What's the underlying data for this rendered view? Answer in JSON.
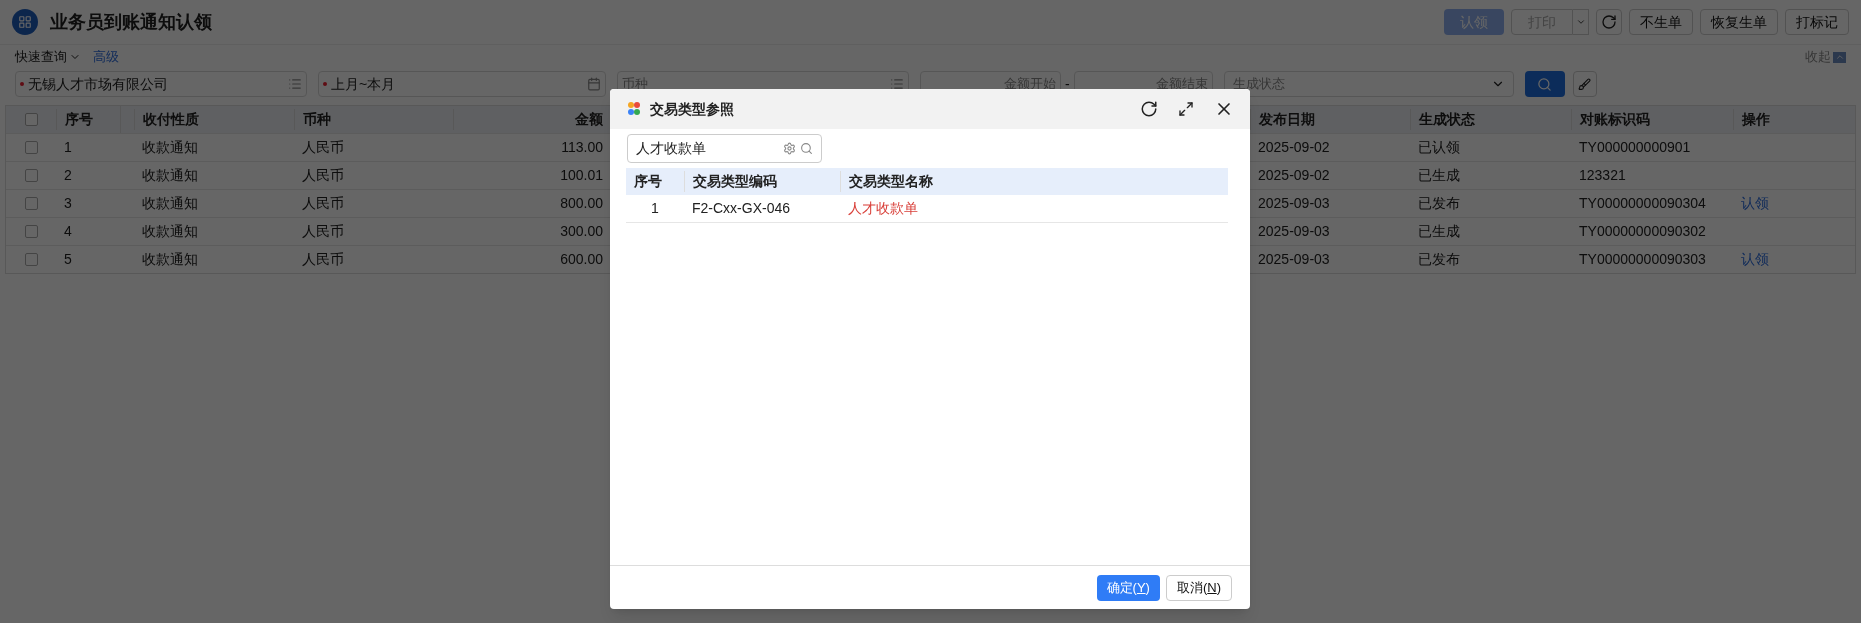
{
  "page": {
    "title": "业务员到账通知认领"
  },
  "toolbar": [
    {
      "kind": "primary",
      "label": "认领",
      "disabled": true
    },
    {
      "kind": "split",
      "label": "打印",
      "disabled": true
    },
    {
      "kind": "refresh"
    },
    {
      "kind": "default",
      "label": "不生单",
      "disabled": false
    },
    {
      "kind": "default",
      "label": "恢复生单",
      "disabled": false
    },
    {
      "kind": "default",
      "label": "打标记",
      "disabled": false
    }
  ],
  "query": {
    "quick": "快速查询",
    "advanced": "高级",
    "collapse": "收起"
  },
  "filters": [
    {
      "kind": "list",
      "value": "无锡人才市场有限公司",
      "required": true
    },
    {
      "kind": "date",
      "value": "上月~本月",
      "required": true
    },
    {
      "kind": "list",
      "placeholder": "币种",
      "required": false
    },
    {
      "kind": "range",
      "placeholder_from": "金额开始",
      "separator": "-",
      "placeholder_to": "金额结束"
    },
    {
      "kind": "dropdown",
      "placeholder": "生成状态"
    }
  ],
  "table": {
    "all_checked": false,
    "columns_left": [
      "序号",
      "收付性质",
      "币种",
      "金额"
    ],
    "columns_right": [
      "发布日期",
      "生成状态",
      "对账标识码",
      "操作"
    ],
    "rows": [
      {
        "checked": false,
        "seq": "1",
        "nature": "收款通知",
        "currency": "人民币",
        "amount": "113.00",
        "date": "2025-09-02",
        "status": "已认领",
        "code": "TY000000000901"
      },
      {
        "checked": false,
        "seq": "2",
        "nature": "收款通知",
        "currency": "人民币",
        "amount": "100.01",
        "date": "2025-09-02",
        "status": "已生成",
        "code": "123321"
      },
      {
        "checked": false,
        "seq": "3",
        "nature": "收款通知",
        "currency": "人民币",
        "amount": "800.00",
        "date": "2025-09-03",
        "status": "已发布",
        "code": "TY00000000090304",
        "action": "认领"
      },
      {
        "checked": false,
        "seq": "4",
        "nature": "收款通知",
        "currency": "人民币",
        "amount": "300.00",
        "date": "2025-09-03",
        "status": "已生成",
        "code": "TY00000000090302"
      },
      {
        "checked": false,
        "seq": "5",
        "nature": "收款通知",
        "currency": "人民币",
        "amount": "600.00",
        "date": "2025-09-03",
        "status": "已发布",
        "code": "TY00000000090303",
        "action": "认领"
      }
    ]
  },
  "dialog": {
    "title": "交易类型参照",
    "search": {
      "value": "人才收款单"
    },
    "columns": [
      "序号",
      "交易类型编码",
      "交易类型名称"
    ],
    "rows": [
      {
        "seq": "1",
        "code": "F2-Cxx-GX-046",
        "name": "人才收款单",
        "selected": true
      }
    ],
    "buttons": [
      {
        "kind": "primary",
        "label": "确定(",
        "hotkey": "Y",
        "suffix": ")"
      },
      {
        "kind": "default",
        "label": "取消(",
        "hotkey": "N",
        "suffix": ")"
      }
    ]
  }
}
